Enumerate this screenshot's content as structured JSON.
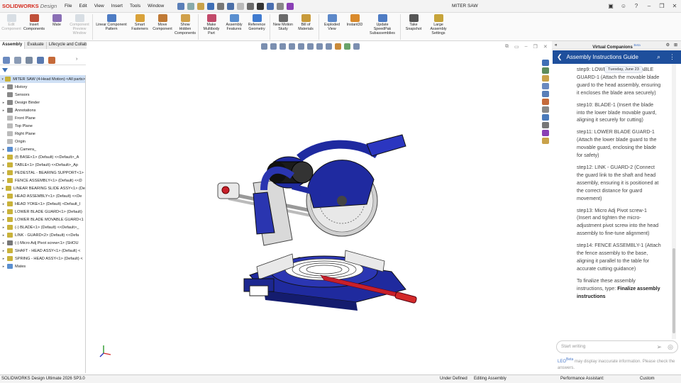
{
  "app": {
    "logo_brand": "SOLIDWORKS",
    "logo_suffix": "Design",
    "doc_title": "MITER SAW"
  },
  "menu": [
    "File",
    "Edit",
    "View",
    "Insert",
    "Tools",
    "Window"
  ],
  "ribbon": [
    {
      "label": "Edit Component",
      "disabled": true,
      "color": "#9ab"
    },
    {
      "label": "Insert Components",
      "disabled": false,
      "color": "#c0503a"
    },
    {
      "label": "Mate",
      "disabled": false,
      "color": "#8a6fb5"
    },
    {
      "label": "Component Preview Window",
      "disabled": true,
      "color": "#9ab"
    },
    {
      "label": "Linear Component Pattern",
      "disabled": false,
      "color": "#4e7cc4"
    },
    {
      "label": "Smart Fasteners",
      "disabled": false,
      "color": "#d9a23a"
    },
    {
      "label": "Move Component",
      "disabled": false,
      "color": "#c07a35"
    },
    {
      "label": "Show Hidden Components",
      "disabled": false,
      "color": "#d1a14a"
    },
    {
      "label": "Make Multibody Part",
      "disabled": false,
      "color": "#c24a6a"
    },
    {
      "label": "Assembly Features",
      "disabled": false,
      "color": "#5a8fd0"
    },
    {
      "label": "Reference Geometry",
      "disabled": false,
      "color": "#3f7bd0"
    },
    {
      "label": "New Motion Study",
      "disabled": false,
      "color": "#6b6b6b"
    },
    {
      "label": "Bill of Materials",
      "disabled": false,
      "color": "#c89a3a"
    },
    {
      "label": "Exploded View",
      "disabled": false,
      "color": "#5c88c9"
    },
    {
      "label": "Instant3D",
      "disabled": false,
      "color": "#d98a2b"
    },
    {
      "label": "Update SpeedPak Subassemblies",
      "disabled": false,
      "color": "#4e7cc4"
    },
    {
      "label": "Take Snapshot",
      "disabled": false,
      "color": "#555"
    },
    {
      "label": "Large Assembly Settings",
      "disabled": false,
      "color": "#c7a43a"
    }
  ],
  "tabs": [
    "Assembly",
    "Evaluate",
    "Lifecycle and Collaboration"
  ],
  "tree": {
    "root": "MITER SAW (4-Head Motion) <All parts>",
    "items": [
      {
        "label": "History",
        "exp": "▸",
        "color": "#888"
      },
      {
        "label": "Sensors",
        "exp": "",
        "color": "#888"
      },
      {
        "label": "Design Binder",
        "exp": "▸",
        "color": "#888"
      },
      {
        "label": "Annotations",
        "exp": "▸",
        "color": "#888"
      },
      {
        "label": "Front Plane",
        "exp": "",
        "color": "#bbb"
      },
      {
        "label": "Top Plane",
        "exp": "",
        "color": "#bbb"
      },
      {
        "label": "Right Plane",
        "exp": "",
        "color": "#bbb"
      },
      {
        "label": "Origin",
        "exp": "",
        "color": "#bbb"
      },
      {
        "label": "(-) Camera_",
        "exp": "▸",
        "color": "#5a8fd0"
      },
      {
        "label": "(f) BASE<1> (Default) <<Default>_A",
        "exp": "▸",
        "color": "#c9b23a"
      },
      {
        "label": "TABLE<1> (Default) <<Default>_Ap",
        "exp": "▸",
        "color": "#c9b23a"
      },
      {
        "label": "PEDESTAL - BEARING SUPPORT<1>",
        "exp": "▸",
        "color": "#c9b23a"
      },
      {
        "label": "FENCE ASSEMBLY<1> (Default) <<D",
        "exp": "▸",
        "color": "#c9b23a"
      },
      {
        "label": "LINEAR BEARING SLIDE ASSY<1> (De",
        "exp": "▸",
        "color": "#c9b23a"
      },
      {
        "label": "HEAD ASSEMBLY<1> (Default) <<De",
        "exp": "▸",
        "color": "#c9b23a"
      },
      {
        "label": "HEAD YOKE<1> (Default) <Default_I",
        "exp": "▸",
        "color": "#c9b23a"
      },
      {
        "label": "LOWER BLADE GUARD<1> (Default)",
        "exp": "▸",
        "color": "#c9b23a"
      },
      {
        "label": "LOWER BLADE MOVABLE GUARD<1",
        "exp": "▸",
        "color": "#c9b23a"
      },
      {
        "label": "(-) BLADE<1> (Default) <<Default>_",
        "exp": "▸",
        "color": "#c9b23a"
      },
      {
        "label": "LINK - GUARD<2> (Default) <<Defa",
        "exp": "▸",
        "color": "#c9b23a"
      },
      {
        "label": "(-) Micro Adj Pivot screw<1> (SHOU",
        "exp": "▸",
        "color": "#777"
      },
      {
        "label": "SHAFT - HEAD ASSY<1> (Default) <",
        "exp": "▸",
        "color": "#c9b23a"
      },
      {
        "label": "SPRING - HEAD ASSY<1> (Default) <",
        "exp": "▸",
        "color": "#c9b23a"
      },
      {
        "label": "Mates",
        "exp": "▸",
        "color": "#5a8fd0"
      }
    ]
  },
  "virtual_companions": {
    "header": "Virtual Companions",
    "header_badge": "Beta",
    "guide_title": "Assembly Instructions Guide",
    "date_pill": "Tuesday, June 23",
    "steps": [
      "step9: LOWER BLADE MOVABLE GUARD-1 (Attach the movable blade guard to the head assembly, ensuring it encloses the blade area securely)",
      "step10: BLADE-1 (Insert the blade into the lower blade movable guard, aligning it securely for cutting)",
      "step11: LOWER BLADE GUARD-1 (Attach the lower blade guard to the movable guard, enclosing the blade for safety)",
      "step12: LINK - GUARD-2 (Connect the guard link to the shaft and head assembly, ensuring it is positioned at the correct distance for guard movement)",
      "step13: Micro Adj Pivot screw-1 (Insert and tighten the micro-adjustment pivot screw into the head assembly to fine-tune alignment)",
      "step14: FENCE ASSEMBLY-1 (Attach the fence assembly to the base, aligning it parallel to the table for accurate cutting guidance)"
    ],
    "finalize_text": "To finalize these assembly instructions, type:",
    "finalize_bold": "Finalize assembly instructions",
    "input_placeholder": "Start writing",
    "leo_label": "LEO",
    "leo_badge": "Beta",
    "disclaimer": "may display inaccurate information. Please check the answers."
  },
  "status": {
    "product": "SOLIDWORKS Design Ultimate 2026 SP3.0",
    "state": "Under Defined",
    "mode": "Editing Assembly",
    "perf": "Performance Assistant:",
    "units": "Custom"
  }
}
